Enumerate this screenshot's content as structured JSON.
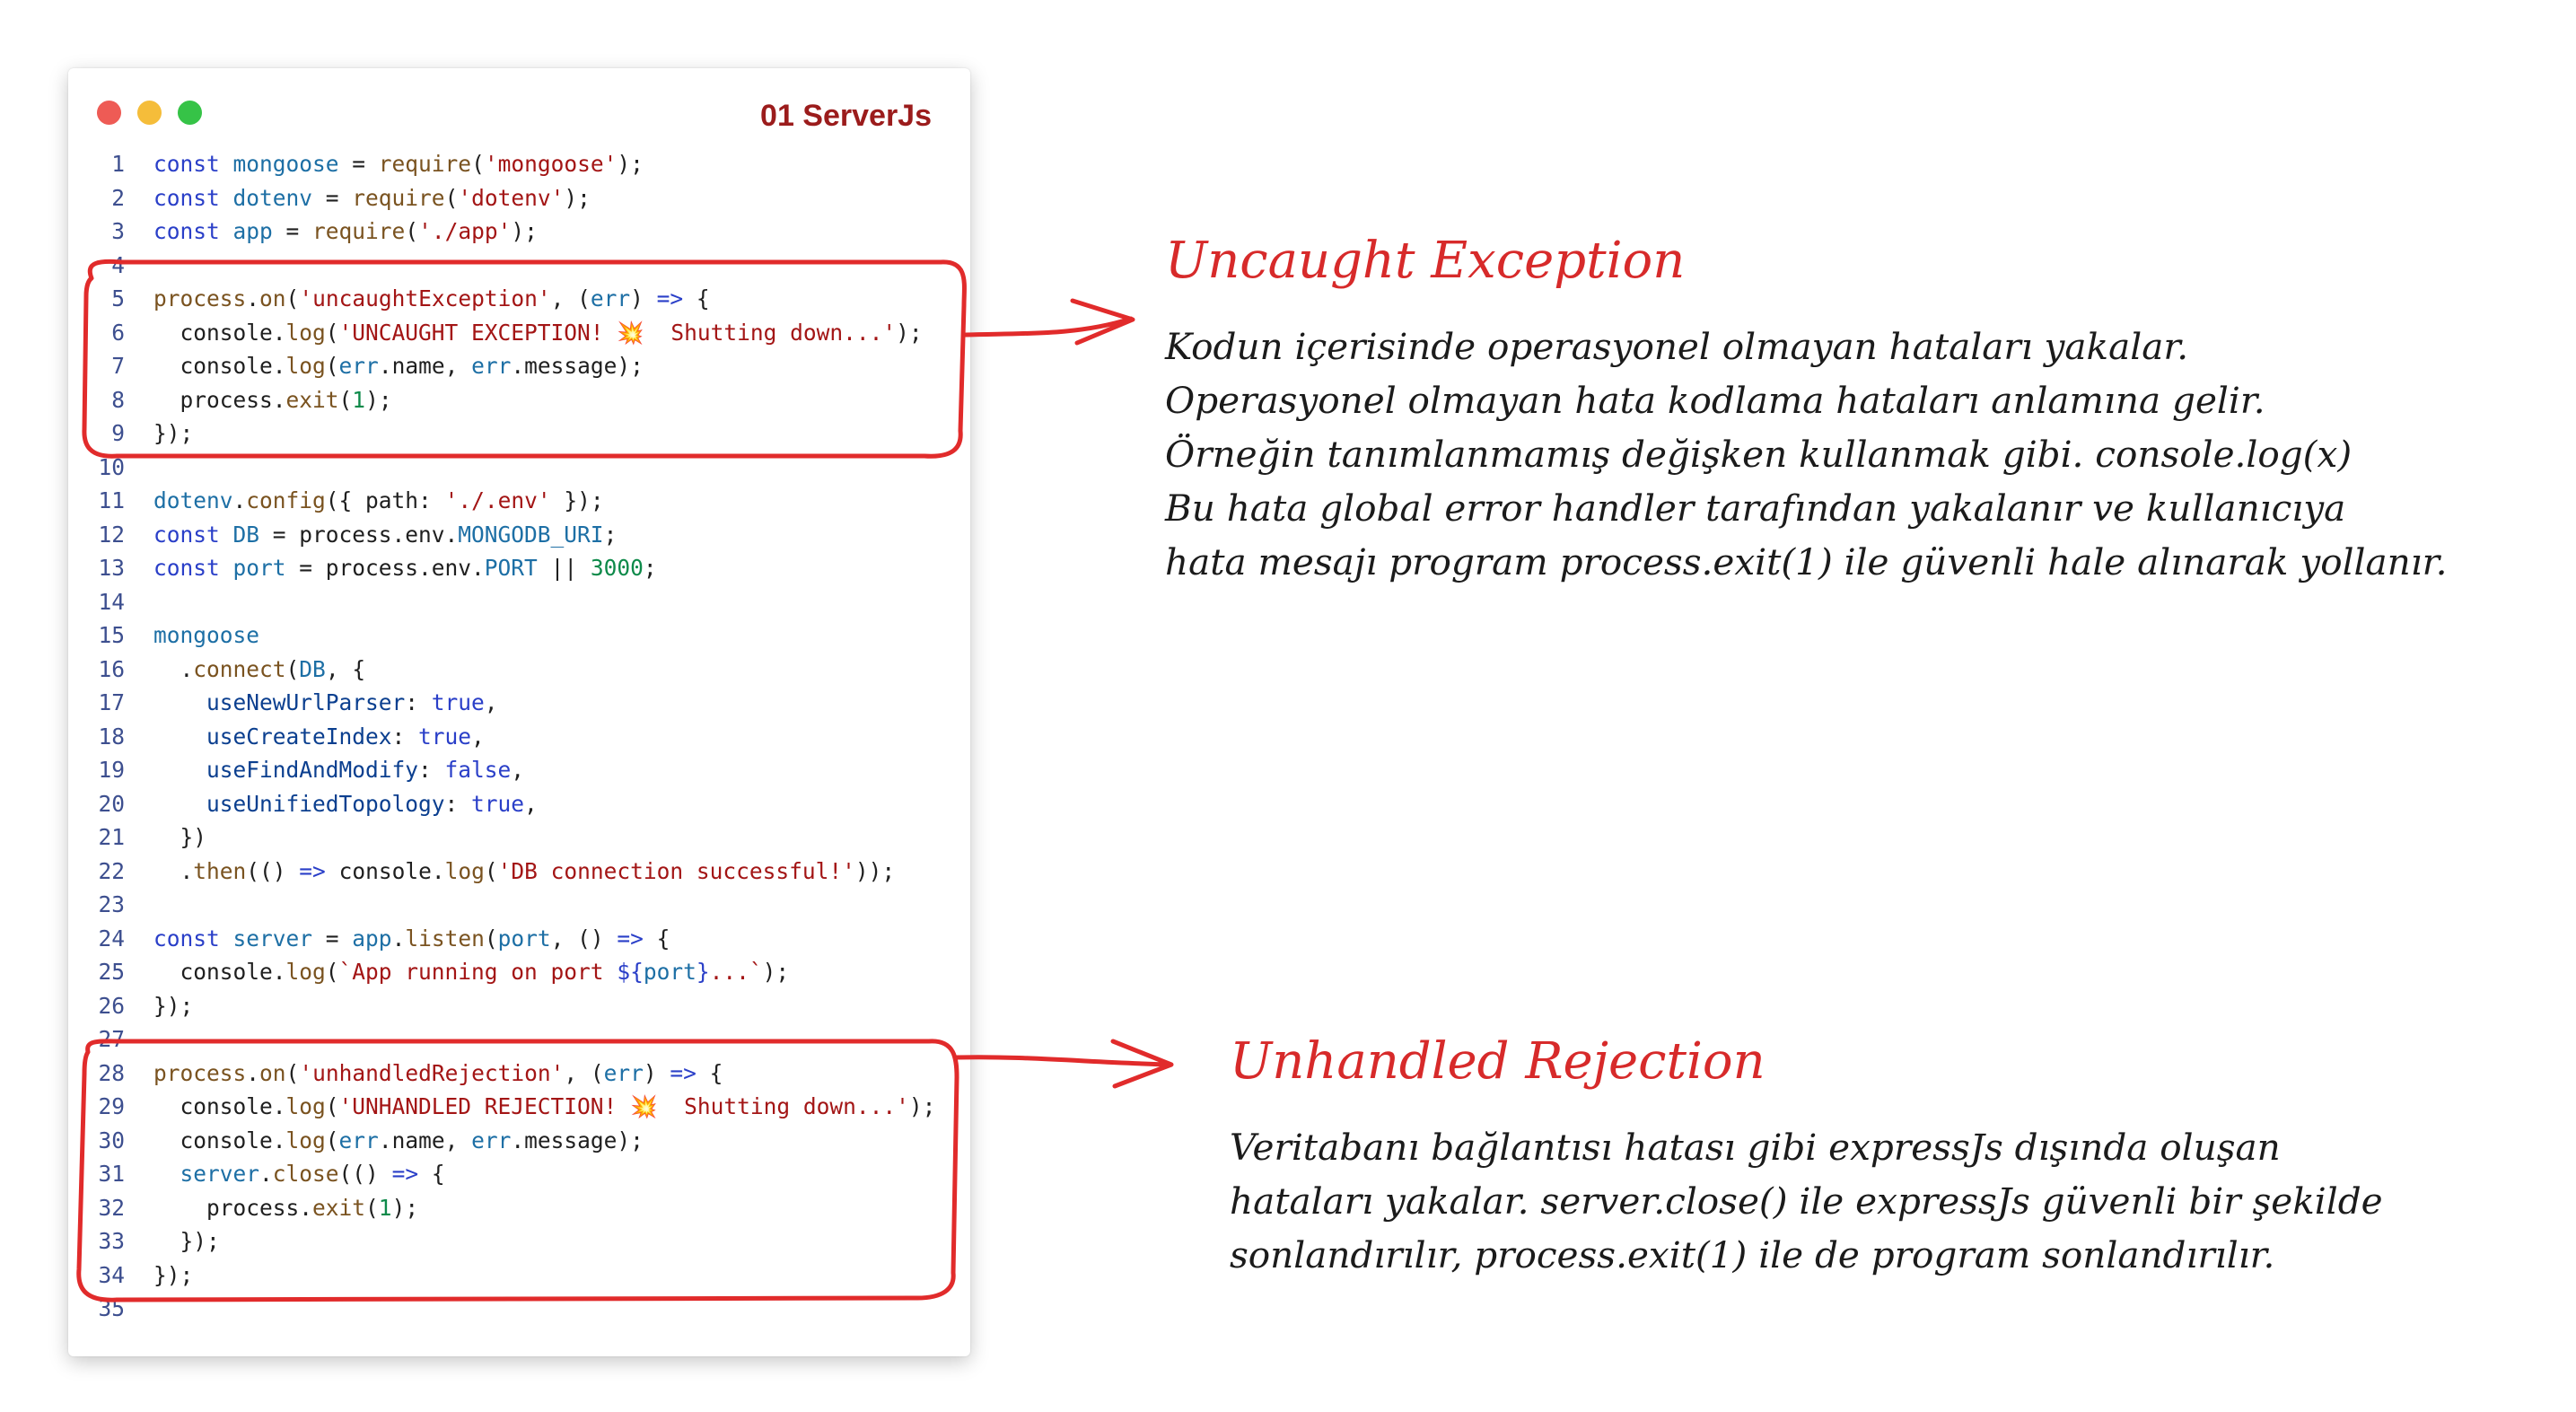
{
  "window": {
    "title": "01 ServerJs"
  },
  "code_lines": [
    {
      "n": "1",
      "segs": [
        [
          "kw",
          "const"
        ],
        [
          "",
          ""
        ],
        [
          "var",
          " mongoose"
        ],
        [
          "",
          " = "
        ],
        [
          "fn",
          "require"
        ],
        [
          "",
          "("
        ],
        [
          "str",
          "'mongoose'"
        ],
        [
          "",
          ");"
        ]
      ]
    },
    {
      "n": "2",
      "segs": [
        [
          "kw",
          "const"
        ],
        [
          "var",
          " dotenv"
        ],
        [
          "",
          " = "
        ],
        [
          "fn",
          "require"
        ],
        [
          "",
          "("
        ],
        [
          "str",
          "'dotenv'"
        ],
        [
          "",
          ");"
        ]
      ]
    },
    {
      "n": "3",
      "segs": [
        [
          "kw",
          "const"
        ],
        [
          "var",
          " app"
        ],
        [
          "",
          " = "
        ],
        [
          "fn",
          "require"
        ],
        [
          "",
          "("
        ],
        [
          "str",
          "'./app'"
        ],
        [
          "",
          ");"
        ]
      ]
    },
    {
      "n": "4",
      "segs": []
    },
    {
      "n": "5",
      "segs": [
        [
          "fn",
          "process"
        ],
        [
          "",
          "."
        ],
        [
          "fn",
          "on"
        ],
        [
          "",
          "("
        ],
        [
          "str",
          "'uncaughtException'"
        ],
        [
          "",
          ", ("
        ],
        [
          "var",
          "err"
        ],
        [
          "",
          ") "
        ],
        [
          "kw",
          "=>"
        ],
        [
          "",
          " {"
        ]
      ]
    },
    {
      "n": "6",
      "segs": [
        [
          "",
          "  console."
        ],
        [
          "fn",
          "log"
        ],
        [
          "",
          "("
        ],
        [
          "str",
          "'UNCAUGHT EXCEPTION! "
        ],
        [
          "emoji",
          "💥"
        ],
        [
          "str",
          "  Shutting down...'"
        ],
        [
          "",
          ");"
        ]
      ]
    },
    {
      "n": "7",
      "segs": [
        [
          "",
          "  console."
        ],
        [
          "fn",
          "log"
        ],
        [
          "",
          "("
        ],
        [
          "var",
          "err"
        ],
        [
          "",
          ".name, "
        ],
        [
          "var",
          "err"
        ],
        [
          "",
          ".message);"
        ]
      ]
    },
    {
      "n": "8",
      "segs": [
        [
          "",
          "  process."
        ],
        [
          "fn",
          "exit"
        ],
        [
          "",
          "("
        ],
        [
          "num",
          "1"
        ],
        [
          "",
          ");"
        ]
      ]
    },
    {
      "n": "9",
      "segs": [
        [
          "",
          "});"
        ]
      ]
    },
    {
      "n": "10",
      "segs": []
    },
    {
      "n": "11",
      "segs": [
        [
          "var",
          "dotenv"
        ],
        [
          "",
          "."
        ],
        [
          "fn",
          "config"
        ],
        [
          "",
          "({ path: "
        ],
        [
          "str",
          "'./.env'"
        ],
        [
          "",
          " });"
        ]
      ]
    },
    {
      "n": "12",
      "segs": [
        [
          "kw",
          "const"
        ],
        [
          "var",
          " DB"
        ],
        [
          "",
          " = process.env."
        ],
        [
          "var",
          "MONGODB_URI"
        ],
        [
          "",
          ";"
        ]
      ]
    },
    {
      "n": "13",
      "segs": [
        [
          "kw",
          "const"
        ],
        [
          "var",
          " port"
        ],
        [
          "",
          " = process.env."
        ],
        [
          "var",
          "PORT"
        ],
        [
          "",
          " || "
        ],
        [
          "num",
          "3000"
        ],
        [
          "",
          ";"
        ]
      ]
    },
    {
      "n": "14",
      "segs": []
    },
    {
      "n": "15",
      "segs": [
        [
          "var",
          "mongoose"
        ]
      ]
    },
    {
      "n": "16",
      "segs": [
        [
          "",
          "  ."
        ],
        [
          "fn",
          "connect"
        ],
        [
          "",
          "("
        ],
        [
          "var",
          "DB"
        ],
        [
          "",
          ", {"
        ]
      ]
    },
    {
      "n": "17",
      "segs": [
        [
          "prop",
          "    useNewUrlParser"
        ],
        [
          "",
          ": "
        ],
        [
          "bool",
          "true"
        ],
        [
          "",
          ","
        ]
      ]
    },
    {
      "n": "18",
      "segs": [
        [
          "prop",
          "    useCreateIndex"
        ],
        [
          "",
          ": "
        ],
        [
          "bool",
          "true"
        ],
        [
          "",
          ","
        ]
      ]
    },
    {
      "n": "19",
      "segs": [
        [
          "prop",
          "    useFindAndModify"
        ],
        [
          "",
          ": "
        ],
        [
          "bool",
          "false"
        ],
        [
          "",
          ","
        ]
      ]
    },
    {
      "n": "20",
      "segs": [
        [
          "prop",
          "    useUnifiedTopology"
        ],
        [
          "",
          ": "
        ],
        [
          "bool",
          "true"
        ],
        [
          "",
          ","
        ]
      ]
    },
    {
      "n": "21",
      "segs": [
        [
          "",
          "  })"
        ]
      ]
    },
    {
      "n": "22",
      "segs": [
        [
          "",
          "  ."
        ],
        [
          "fn",
          "then"
        ],
        [
          "",
          "(() "
        ],
        [
          "kw",
          "=>"
        ],
        [
          "",
          " console."
        ],
        [
          "fn",
          "log"
        ],
        [
          "",
          "("
        ],
        [
          "str",
          "'DB connection successful!'"
        ],
        [
          "",
          "));"
        ]
      ]
    },
    {
      "n": "23",
      "segs": []
    },
    {
      "n": "24",
      "segs": [
        [
          "kw",
          "const"
        ],
        [
          "var",
          " server"
        ],
        [
          "",
          " = "
        ],
        [
          "var",
          "app"
        ],
        [
          "",
          "."
        ],
        [
          "fn",
          "listen"
        ],
        [
          "",
          "("
        ],
        [
          "var",
          "port"
        ],
        [
          "",
          ", () "
        ],
        [
          "kw",
          "=>"
        ],
        [
          "",
          " {"
        ]
      ]
    },
    {
      "n": "25",
      "segs": [
        [
          "",
          "  console."
        ],
        [
          "fn",
          "log"
        ],
        [
          "",
          "("
        ],
        [
          "str",
          "`App running on port "
        ],
        [
          "kw",
          "${"
        ],
        [
          "var",
          "port"
        ],
        [
          "kw",
          "}"
        ],
        [
          "str",
          "...`"
        ],
        [
          "",
          ");"
        ]
      ]
    },
    {
      "n": "26",
      "segs": [
        [
          "",
          "});"
        ]
      ]
    },
    {
      "n": "27",
      "segs": []
    },
    {
      "n": "28",
      "segs": [
        [
          "fn",
          "process"
        ],
        [
          "",
          "."
        ],
        [
          "fn",
          "on"
        ],
        [
          "",
          "("
        ],
        [
          "str",
          "'unhandledRejection'"
        ],
        [
          "",
          ", ("
        ],
        [
          "var",
          "err"
        ],
        [
          "",
          ") "
        ],
        [
          "kw",
          "=>"
        ],
        [
          "",
          " {"
        ]
      ]
    },
    {
      "n": "29",
      "segs": [
        [
          "",
          "  console."
        ],
        [
          "fn",
          "log"
        ],
        [
          "",
          "("
        ],
        [
          "str",
          "'UNHANDLED REJECTION! "
        ],
        [
          "emoji",
          "💥"
        ],
        [
          "str",
          "  Shutting down...'"
        ],
        [
          "",
          ");"
        ]
      ]
    },
    {
      "n": "30",
      "segs": [
        [
          "",
          "  console."
        ],
        [
          "fn",
          "log"
        ],
        [
          "",
          "("
        ],
        [
          "var",
          "err"
        ],
        [
          "",
          ".name, "
        ],
        [
          "var",
          "err"
        ],
        [
          "",
          ".message);"
        ]
      ]
    },
    {
      "n": "31",
      "segs": [
        [
          "var",
          "  server"
        ],
        [
          "",
          "."
        ],
        [
          "fn",
          "close"
        ],
        [
          "",
          "(() "
        ],
        [
          "kw",
          "=>"
        ],
        [
          "",
          " {"
        ]
      ]
    },
    {
      "n": "32",
      "segs": [
        [
          "",
          "    process."
        ],
        [
          "fn",
          "exit"
        ],
        [
          "",
          "("
        ],
        [
          "num",
          "1"
        ],
        [
          "",
          ");"
        ]
      ]
    },
    {
      "n": "33",
      "segs": [
        [
          "",
          "  });"
        ]
      ]
    },
    {
      "n": "34",
      "segs": [
        [
          "",
          "});"
        ]
      ]
    },
    {
      "n": "35",
      "segs": []
    }
  ],
  "notes": {
    "uncaught": {
      "title": "Uncaught Exception",
      "lines": [
        "Kodun içerisinde operasyonel olmayan hataları yakalar.",
        "Operasyonel olmayan hata kodlama hataları anlamına gelir.",
        "Örneğin tanımlanmamış değişken kullanmak gibi. console.log(x)",
        "Bu hata global error handler tarafından yakalanır ve kullanıcıya",
        "hata mesajı program process.exit(1) ile güvenli hale alınarak yollanır."
      ]
    },
    "unhandled": {
      "title": "Unhandled Rejection",
      "lines": [
        "Veritabanı bağlantısı hatası gibi expressJs dışında oluşan",
        "hataları yakalar. server.close() ile expressJs güvenli bir şekilde",
        "sonlandırılır, process.exit(1) ile de program sonlandırılır."
      ]
    }
  },
  "colors": {
    "annotation": "#e12b2b",
    "title": "#9b1c1c"
  }
}
